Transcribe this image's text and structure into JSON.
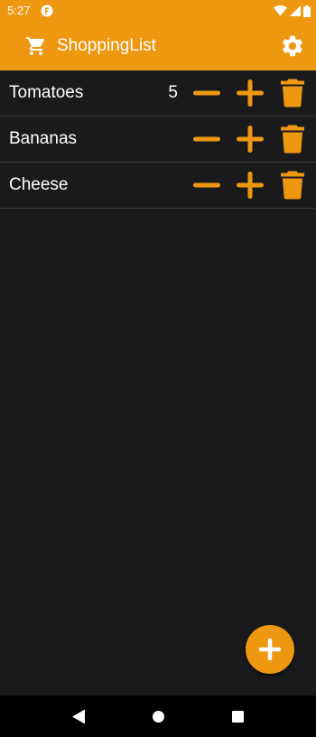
{
  "status_bar": {
    "time": "5:27",
    "icons": [
      "app-notification-icon",
      "wifi-icon",
      "cellular-signal-icon",
      "battery-icon"
    ]
  },
  "app_bar": {
    "title": "ShoppingList",
    "leading_icon": "cart-icon",
    "action_icon": "settings-gear-icon"
  },
  "items": [
    {
      "name": "Tomatoes",
      "quantity": "5"
    },
    {
      "name": "Bananas",
      "quantity": ""
    },
    {
      "name": "Cheese",
      "quantity": ""
    }
  ],
  "row_actions": {
    "decrease_icon": "minus-icon",
    "increase_icon": "plus-icon",
    "delete_icon": "trash-icon"
  },
  "fab": {
    "icon": "plus-icon"
  },
  "nav_bar": {
    "buttons": [
      "back-icon",
      "home-icon",
      "recents-icon"
    ]
  },
  "colors": {
    "accent": "#ee9812",
    "background": "#1a1a1c",
    "divider": "#3a3a3c",
    "text": "#ffffff",
    "nav_background": "#000000"
  }
}
